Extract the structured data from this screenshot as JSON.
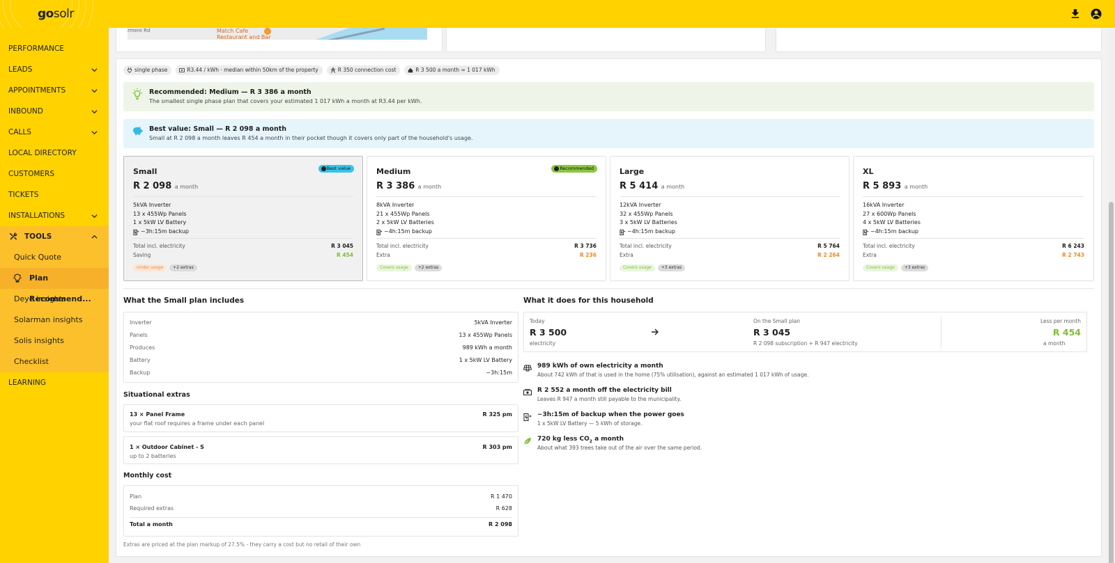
{
  "app": {
    "logo_bold": "go",
    "logo_rest": "solr"
  },
  "sidebar": {
    "items": [
      {
        "label": "PERFORMANCE",
        "chevron": false
      },
      {
        "label": "LEADS",
        "chevron": true
      },
      {
        "label": "APPOINTMENTS",
        "chevron": true
      },
      {
        "label": "INBOUND",
        "chevron": true
      },
      {
        "label": "CALLS",
        "chevron": true
      },
      {
        "label": "LOCAL DIRECTORY",
        "chevron": false
      },
      {
        "label": "CUSTOMERS",
        "chevron": false
      },
      {
        "label": "TICKETS",
        "chevron": false
      },
      {
        "label": "INSTALLATIONS",
        "chevron": true
      }
    ],
    "tools_label": "TOOLS",
    "tools_sub": [
      "Quick Quote",
      "Plan Recommend...",
      "Deye insights",
      "Solarman insights",
      "Solis insights",
      "Checklist"
    ],
    "learning_label": "LEARNING"
  },
  "map": {
    "street": "rmere Rd",
    "poi_line1": "Match Cafe",
    "poi_line2": "Restaurant and Bar"
  },
  "chips": [
    "single phase",
    "R3.44 / kWh · median within 50km of the property",
    "R 350 connection cost",
    "R 3 500 a month ≈ 1 017 kWh"
  ],
  "recommended": {
    "title": "Recommended: Medium — R 3 386 a month",
    "desc": "The smallest single phase plan that covers your estimated 1 017 kWh a month at R3.44 per kWh."
  },
  "best_value": {
    "title": "Best value: Small — R 2 098 a month",
    "desc": "Small at R 2 098 a month leaves R 454 a month in their pocket though it covers only part of the household's usage."
  },
  "plans": [
    {
      "name": "Small",
      "price": "R 2 098",
      "per": "a month",
      "badge": "Best value",
      "inverter": "5kVA Inverter",
      "panels": "13 x 455Wp Panels",
      "battery": "1 x 5kW LV Battery",
      "backup": "~3h:15m backup",
      "total_label": "Total incl. electricity",
      "total": "R 3 045",
      "diff_label": "Saving",
      "diff": "R 454",
      "usage_tag": "Under usage",
      "extras_tag": "+2 extras"
    },
    {
      "name": "Medium",
      "price": "R 3 386",
      "per": "a month",
      "badge": "Recommended",
      "inverter": "8kVA Inverter",
      "panels": "21 x 455Wp Panels",
      "battery": "2 x 5kW LV Batteries",
      "backup": "~4h:15m backup",
      "total_label": "Total incl. electricity",
      "total": "R 3 736",
      "diff_label": "Extra",
      "diff": "R 236",
      "usage_tag": "Covers usage",
      "extras_tag": "+2 extras"
    },
    {
      "name": "Large",
      "price": "R 5 414",
      "per": "a month",
      "badge": "",
      "inverter": "12kVA Inverter",
      "panels": "32 x 455Wp Panels",
      "battery": "3 x 5kW LV Batteries",
      "backup": "~4h:15m backup",
      "total_label": "Total incl. electricity",
      "total": "R 5 764",
      "diff_label": "Extra",
      "diff": "R 2 264",
      "usage_tag": "Covers usage",
      "extras_tag": "+3 extras"
    },
    {
      "name": "XL",
      "price": "R 5 893",
      "per": "a month",
      "badge": "",
      "inverter": "16kVA Inverter",
      "panels": "27 x 600Wp Panels",
      "battery": "4 x 5kW LV Batteries",
      "backup": "~4h:15m backup",
      "total_label": "Total incl. electricity",
      "total": "R 6 243",
      "diff_label": "Extra",
      "diff": "R 2 743",
      "usage_tag": "Covers usage",
      "extras_tag": "+3 extras"
    }
  ],
  "includes": {
    "title": "What the Small plan includes",
    "rows": [
      {
        "k": "Inverter",
        "v": "5kVA Inverter"
      },
      {
        "k": "Panels",
        "v": "13 x 455Wp Panels"
      },
      {
        "k": "Produces",
        "v": "989 kWh a month"
      },
      {
        "k": "Battery",
        "v": "1 x 5kW LV Battery"
      },
      {
        "k": "Backup",
        "v": "~3h:15m"
      }
    ]
  },
  "extras": {
    "title": "Situational extras",
    "items": [
      {
        "name": "13 × Panel Frame",
        "price": "R 325 pm",
        "desc": "your flat roof requires a frame under each panel"
      },
      {
        "name": "1 × Outdoor Cabinet - S",
        "price": "R 303 pm",
        "desc": "up to 2 batteries"
      }
    ]
  },
  "monthly": {
    "title": "Monthly cost",
    "plan_label": "Plan",
    "plan": "R 1 470",
    "req_label": "Required extras",
    "req": "R 628",
    "total_label": "Total a month",
    "total": "R 2 098"
  },
  "note": "Extras are priced at the plan markup of 27.5% - they carry a cost but no retail of their own",
  "household": {
    "title": "What it does for this household",
    "today_label": "Today",
    "today_value": "R 3 500",
    "today_sub": "electricity",
    "plan_label": "On the Small plan",
    "plan_value": "R 3 045",
    "plan_sub": "R 2 098 subscription + R 947 electricity",
    "less_label": "Less per month",
    "less_value": "R 454",
    "less_sub": "a month"
  },
  "facts": [
    {
      "title": "989 kWh of own electricity a month",
      "desc": "About 742 kWh of that is used in the home (75% utilisation), against an estimated 1 017 kWh of usage."
    },
    {
      "title": "R 2 552 a month off the electricity bill",
      "desc": "Leaves R 947 a month still payable to the municipality."
    },
    {
      "title": "~3h:15m of backup when the power goes",
      "desc": "1 x 5kW LV Battery — 5 kWh of storage."
    },
    {
      "title_pre": "720 kg less CO",
      "title_sub": "2",
      "title_post": " a month",
      "desc": "About what 393 trees take out of the air over the same period."
    }
  ]
}
